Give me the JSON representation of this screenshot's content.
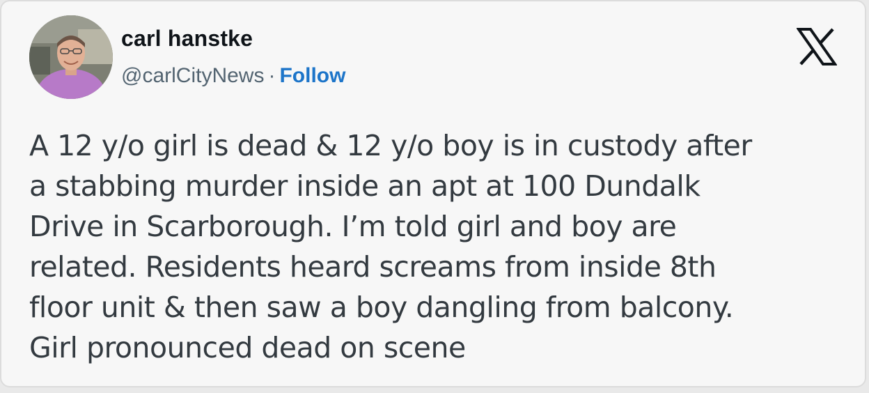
{
  "author": {
    "display_name": "carl hanstke",
    "handle": "@carlCityNews",
    "separator": "·",
    "follow_label": "Follow",
    "avatar_icon": "profile-photo"
  },
  "header": {
    "logo_icon": "x-logo-icon"
  },
  "tweet": {
    "lines": [
      "A 12 y/o girl is dead & 12 y/o boy is in custody after",
      "a stabbing murder inside an apt at 100 Dundalk",
      "Drive in Scarborough.  I’m told girl and boy are",
      "related. Residents heard screams from inside 8th",
      "floor unit & then saw a boy dangling from balcony.",
      "Girl pronounced dead on scene"
    ]
  },
  "colors": {
    "follow": "#1d75c9",
    "name": "#0f1419",
    "handle": "#536471",
    "body_text": "#333a40",
    "card_background": "#f7f7f7"
  }
}
